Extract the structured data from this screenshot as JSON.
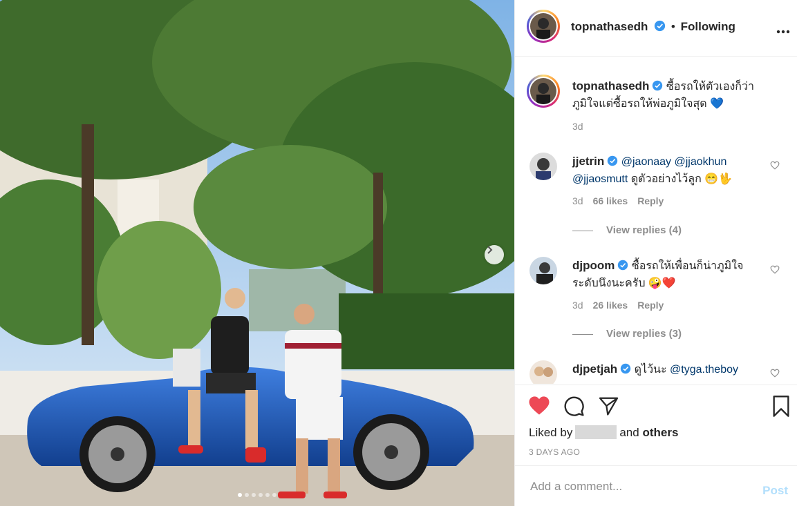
{
  "header": {
    "username": "topnathasedh",
    "separator": "•",
    "follow_status": "Following"
  },
  "caption": {
    "username": "topnathasedh",
    "text": "ซื้อรถให้ตัวเองก็ว่าภูมิใจแต่ซื้อรถให้พ่อภูมิใจสุด 💙",
    "time": "3d"
  },
  "comments": [
    {
      "username": "jjetrin",
      "mentions": [
        "@jaonaay",
        "@jjaokhun",
        "@jjaosmutt"
      ],
      "text": "ดูตัวอย่างไว้ลูก 😁🖖",
      "time": "3d",
      "likes": "66 likes",
      "reply": "Reply",
      "view_replies": "View replies (4)"
    },
    {
      "username": "djpoom",
      "text": "ซื้อรถให้เพื่อนก็น่าภูมิใจระดับนึงนะครับ 🤪❤️",
      "time": "3d",
      "likes": "26 likes",
      "reply": "Reply",
      "view_replies": "View replies (3)"
    },
    {
      "username": "djpetjah",
      "text": "ดูไว้นะ",
      "mention": "@tyga.theboy"
    }
  ],
  "likes_line": {
    "prefix": "Liked by",
    "middle": "and",
    "suffix": "others"
  },
  "posted_ago": "3 DAYS AGO",
  "add_comment": {
    "placeholder": "Add a comment...",
    "post_label": "Post"
  },
  "icons": {
    "like": "heart-filled-icon",
    "comment": "comment-icon",
    "share": "share-icon",
    "save": "bookmark-icon",
    "more": "more-icon",
    "verified": "verified-badge-icon",
    "next": "chevron-right-icon"
  },
  "colors": {
    "heart_red": "#ed4956",
    "verified_blue": "#3897f0",
    "mention_blue": "#00376b",
    "post_disabled": "#b2dffc",
    "car_blue": "#1e5bb8"
  },
  "carousel": {
    "slides": 6,
    "active_index": 0
  }
}
